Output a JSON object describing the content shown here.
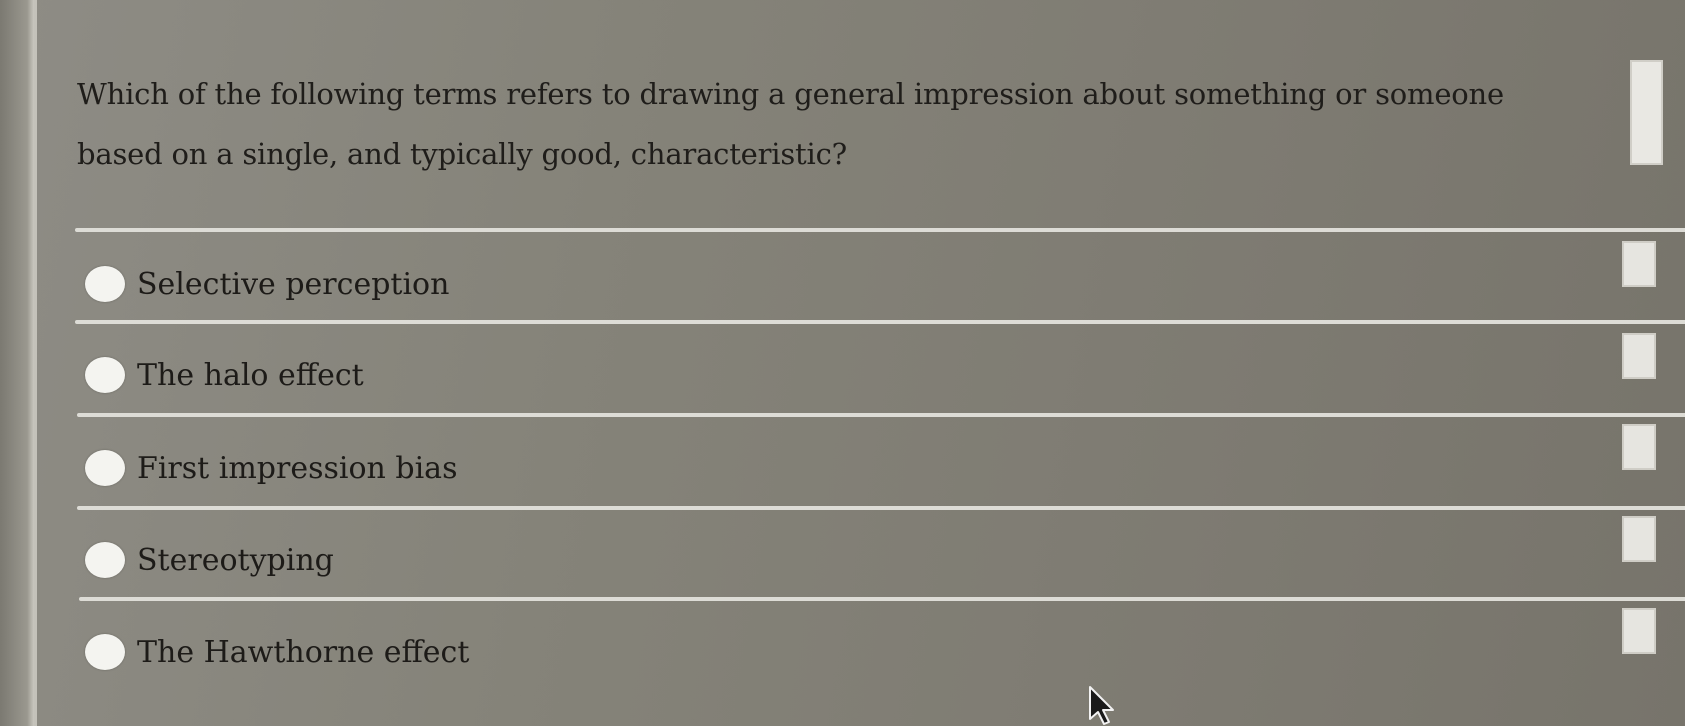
{
  "question": {
    "text": "Which of the following terms refers to drawing a general impression about something or someone based on a single, and typically good, characteristic?"
  },
  "options": [
    {
      "label": "Selective perception",
      "selected": false
    },
    {
      "label": "The halo effect",
      "selected": false
    },
    {
      "label": "First impression bias",
      "selected": false
    },
    {
      "label": "Stereotyping",
      "selected": false
    },
    {
      "label": "The Hawthorne effect",
      "selected": false
    }
  ],
  "colors": {
    "background": "#858379",
    "radio_fill": "#f4f4f0",
    "text": "#1f1d1a",
    "divider": "#dddcd6"
  },
  "icons": {
    "cursor": "mouse-pointer-icon"
  }
}
